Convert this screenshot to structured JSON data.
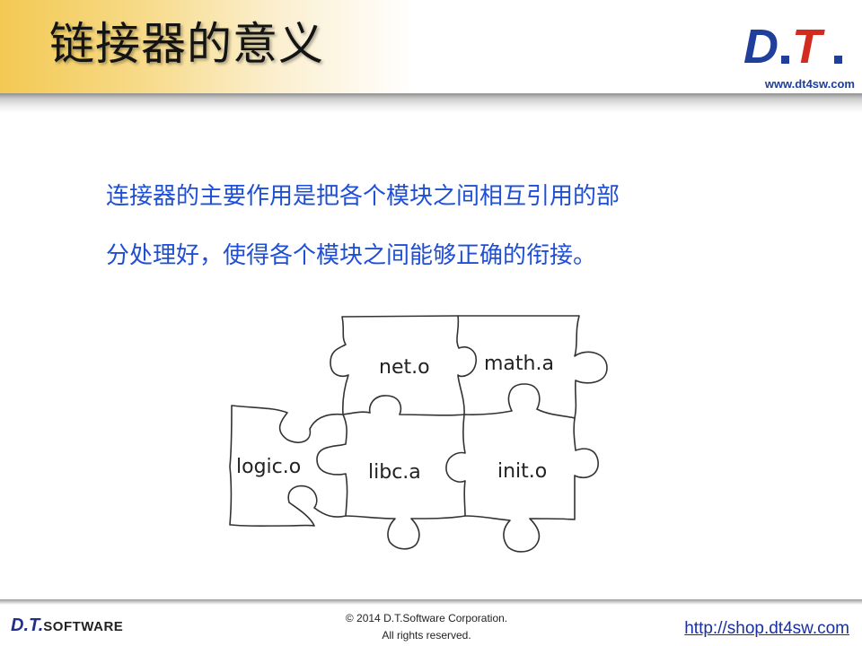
{
  "slide": {
    "title": "链接器的意义",
    "logo_text": "D.T.",
    "site_url": "www.dt4sw.com",
    "body_lines": [
      "连接器的主要作用是把各个模块之间相互引用的部",
      "分处理好，使得各个模块之间能够正确的衔接。"
    ]
  },
  "puzzle": {
    "pieces": [
      "net.o",
      "math.a",
      "logic.o",
      "libc.a",
      "init.o"
    ]
  },
  "footer": {
    "logo_dt": "D.T.",
    "logo_software": "SOFTWARE",
    "copyright_line1": "© 2014 D.T.Software Corporation.",
    "copyright_line2": "All rights reserved.",
    "shop_link": "http://shop.dt4sw.com"
  },
  "colors": {
    "accent_yellow": "#f3c953",
    "body_text_blue": "#1e4fd6",
    "logo_blue": "#1f3f9a",
    "logo_red": "#d32b1e"
  }
}
